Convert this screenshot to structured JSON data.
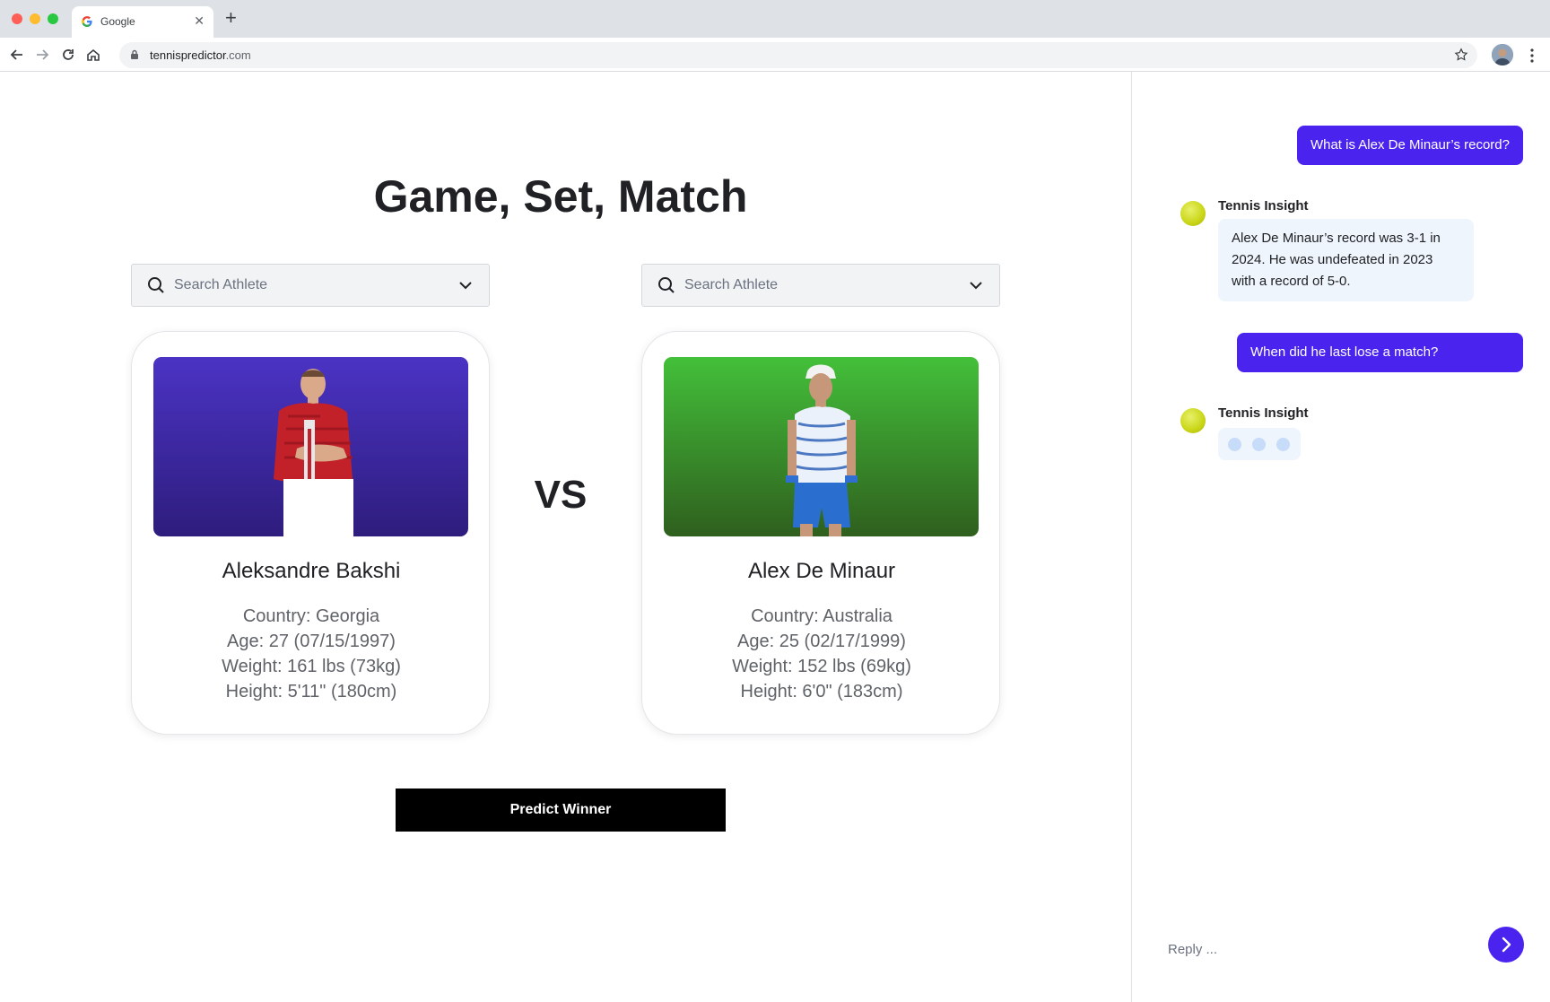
{
  "browser": {
    "tab_title": "Google",
    "url_host": "tennispredictor",
    "url_tld": ".com"
  },
  "main": {
    "title": "Game, Set, Match",
    "vs_label": "VS",
    "search_placeholder": "Search Athlete",
    "predict_button": "Predict Winner",
    "players": [
      {
        "name": "Aleksandre Bakshi",
        "country": "Country: Georgia",
        "age": "Age: 27 (07/15/1997)",
        "weight": "Weight: 161 lbs (73kg)",
        "height": "Height: 5'11\" (180cm)",
        "photo_color": "#4b33c4"
      },
      {
        "name": "Alex De Minaur",
        "country": "Country: Australia",
        "age": "Age: 25 (02/17/1999)",
        "weight": "Weight: 152 lbs (69kg)",
        "height": "Height: 6'0\" (183cm)",
        "photo_color": "#43c03a"
      }
    ]
  },
  "chat": {
    "user_message_1": "What is Alex De Minaur’s record?",
    "bot_name": "Tennis Insight",
    "bot_message_1": "Alex De Minaur’s record was 3-1 in 2024. He was undefeated in 2023 with a record of 5-0.",
    "user_message_2": "When did he last lose a match?",
    "reply_placeholder": "Reply ...",
    "accent_color": "#4a24ee",
    "bot_bubble_color": "#eef5fd"
  }
}
